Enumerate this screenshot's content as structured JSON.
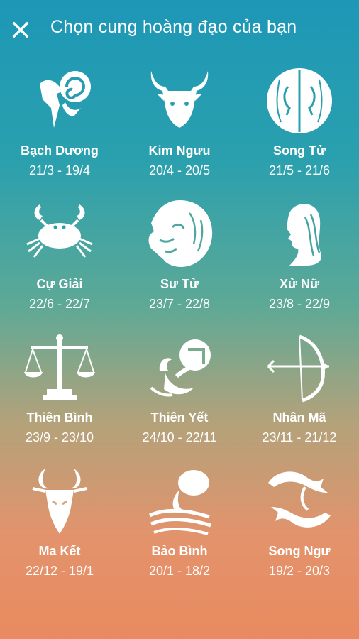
{
  "header": {
    "title": "Chọn cung hoàng đạo của bạn",
    "close_icon": "close-icon"
  },
  "signs": [
    {
      "name": "Bạch Dương",
      "dates": "21/3 - 19/4",
      "icon": "aries-ram-icon"
    },
    {
      "name": "Kim Ngưu",
      "dates": "20/4 - 20/5",
      "icon": "taurus-bull-icon"
    },
    {
      "name": "Song Tử",
      "dates": "21/5 - 21/6",
      "icon": "gemini-twins-icon"
    },
    {
      "name": "Cự Giải",
      "dates": "22/6 - 22/7",
      "icon": "cancer-crab-icon"
    },
    {
      "name": "Sư Tử",
      "dates": "23/7 - 22/8",
      "icon": "leo-lion-icon"
    },
    {
      "name": "Xử Nữ",
      "dates": "23/8 - 22/9",
      "icon": "virgo-maiden-icon"
    },
    {
      "name": "Thiên Bình",
      "dates": "23/9 - 23/10",
      "icon": "libra-scales-icon"
    },
    {
      "name": "Thiên Yết",
      "dates": "24/10 - 22/11",
      "icon": "scorpio-scorpion-icon"
    },
    {
      "name": "Nhân Mã",
      "dates": "23/11 - 21/12",
      "icon": "sagittarius-bow-icon"
    },
    {
      "name": "Ma Kết",
      "dates": "22/12 - 19/1",
      "icon": "capricorn-goat-icon"
    },
    {
      "name": "Bảo Bình",
      "dates": "20/1 - 18/2",
      "icon": "aquarius-water-icon"
    },
    {
      "name": "Song Ngư",
      "dates": "19/2 - 20/3",
      "icon": "pisces-fish-icon"
    }
  ],
  "colors": {
    "background_top": "#1d97b7",
    "background_bottom": "#e98a60",
    "foreground": "#ffffff"
  }
}
